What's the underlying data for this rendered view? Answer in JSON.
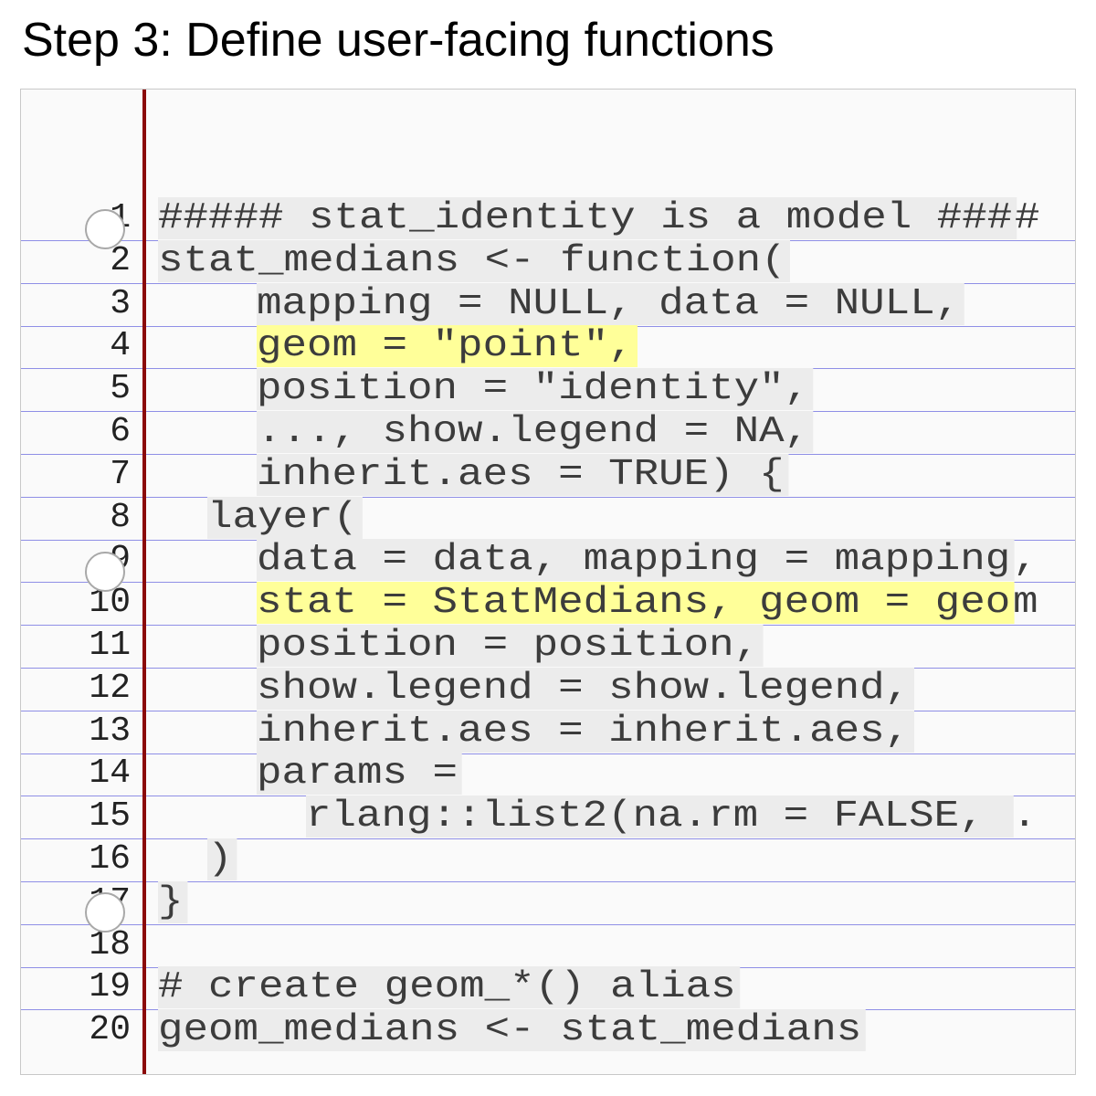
{
  "title": "Step 3: Define user-facing functions",
  "colors": {
    "margin_line": "#8b0a0a",
    "rule_line": "#8f8fe6",
    "highlight": "#ffff99",
    "code_bg": "#ececec"
  },
  "code_lines": [
    {
      "num": "1",
      "indent": 0,
      "text": "##### stat_identity is a model ###",
      "overflow": "#",
      "highlight": false
    },
    {
      "num": "2",
      "indent": 0,
      "text": "stat_medians <- function(",
      "overflow": "",
      "highlight": false
    },
    {
      "num": "3",
      "indent": 2,
      "text": "mapping = NULL, data = NULL,",
      "overflow": "",
      "highlight": false
    },
    {
      "num": "4",
      "indent": 2,
      "text": "geom = \"point\",",
      "overflow": "",
      "highlight": true
    },
    {
      "num": "5",
      "indent": 2,
      "text": "position = \"identity\",",
      "overflow": "",
      "highlight": false
    },
    {
      "num": "6",
      "indent": 2,
      "text": "..., show.legend = NA,",
      "overflow": "",
      "highlight": false
    },
    {
      "num": "7",
      "indent": 2,
      "text": "inherit.aes = TRUE) {",
      "overflow": "",
      "highlight": false
    },
    {
      "num": "8",
      "indent": 1,
      "text": "layer(",
      "overflow": "",
      "highlight": false
    },
    {
      "num": "9",
      "indent": 2,
      "text": "data = data, mapping = mapping",
      "overflow": ",",
      "highlight": false
    },
    {
      "num": "10",
      "indent": 2,
      "text": "stat = StatMedians, geom = geo",
      "overflow": "m",
      "highlight": true
    },
    {
      "num": "11",
      "indent": 2,
      "text": "position = position,",
      "overflow": "",
      "highlight": false
    },
    {
      "num": "12",
      "indent": 2,
      "text": "show.legend = show.legend,",
      "overflow": "",
      "highlight": false
    },
    {
      "num": "13",
      "indent": 2,
      "text": "inherit.aes = inherit.aes,",
      "overflow": "",
      "highlight": false
    },
    {
      "num": "14",
      "indent": 2,
      "text": "params =",
      "overflow": "",
      "highlight": false
    },
    {
      "num": "15",
      "indent": 3,
      "text": "rlang::list2(na.rm = FALSE, ",
      "overflow": ".",
      "highlight": false
    },
    {
      "num": "16",
      "indent": 1,
      "text": ")",
      "overflow": "",
      "highlight": false
    },
    {
      "num": "17",
      "indent": 0,
      "text": "}",
      "overflow": "",
      "highlight": false
    },
    {
      "num": "18",
      "indent": 0,
      "text": "",
      "overflow": "",
      "highlight": false
    },
    {
      "num": "19",
      "indent": 0,
      "text": "# create geom_*() alias",
      "overflow": "",
      "highlight": false
    },
    {
      "num": "20",
      "indent": 0,
      "text": "geom_medians <- stat_medians",
      "overflow": "",
      "highlight": false
    }
  ]
}
